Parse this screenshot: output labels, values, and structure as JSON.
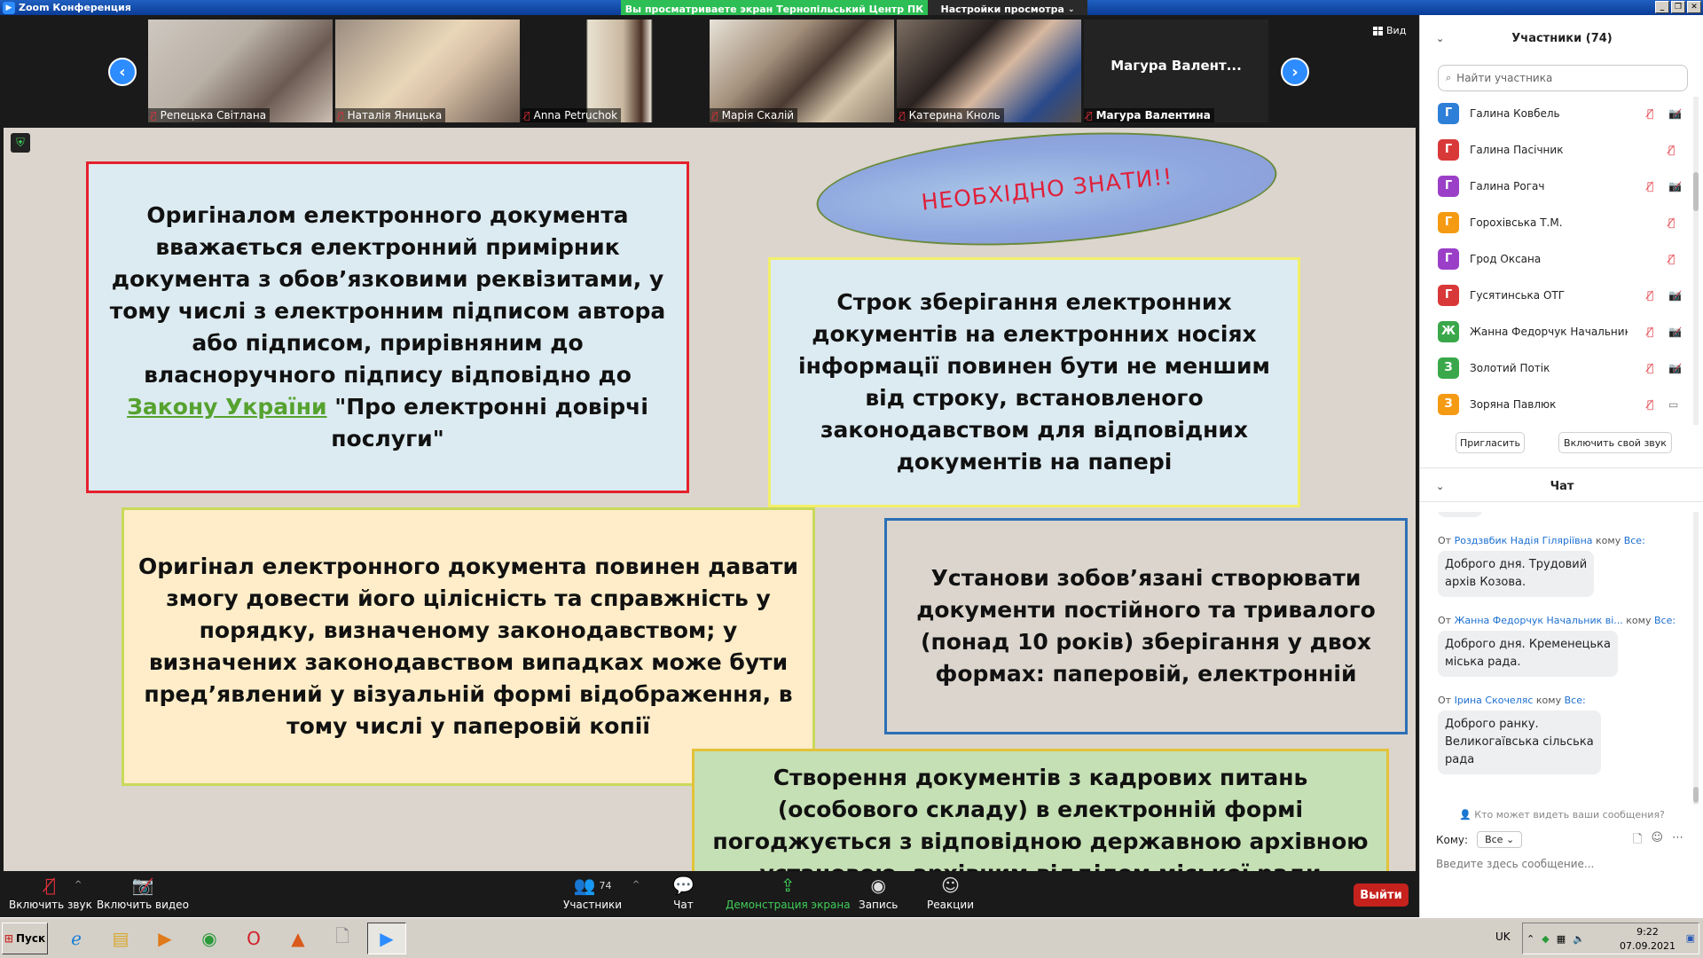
{
  "window": {
    "title": "Zoom Конференция",
    "share_banner": "Вы просматриваете экран Тернопільський Центр ПК",
    "view_settings": "Настройки просмотра"
  },
  "video_strip": {
    "view_label": "Вид",
    "tiles": [
      {
        "name": "Репецька Світлана"
      },
      {
        "name": "Наталія Яницька"
      },
      {
        "name": "Anna Petruchok"
      },
      {
        "name": "Марія Скалій"
      },
      {
        "name": "Катерина Кноль"
      },
      {
        "name": "Магура Валентина",
        "display": "Магура  Валент..."
      }
    ]
  },
  "slide": {
    "ellipse_text": "НЕОБХІДНО ЗНАТИ!!",
    "box1": {
      "before": "Оригіналом електронного документа вважається електронний примірник документа з обов’язковими реквізитами, у тому числі з електронним підписом автора або підписом, прирівняним до власноручного підпису відповідно до ",
      "link": "Закону України",
      "after": " \"Про електронні довірчі послуги\""
    },
    "box2": "Строк зберігання електронних документів на електронних носіях інформації повинен бути не меншим від строку, встановленого законодавством для відповідних документів на папері",
    "box3": "Оригінал електронного документа повинен давати змогу довести його цілісність та справжність у порядку, визначеному законодавством; у визначених законодавством випадках може бути пред’явлений у візуальній формі відображення, в тому числі у паперовій копії",
    "box4": "Установи зобов’язані створювати документи постійного та тривалого (понад 10 років) зберігання у двох формах: паперовій, електронній",
    "box5": "Створення документів з кадрових питань (особового складу) в електронній формі погоджується з відповідною державною архівною установою, архівним відділом міської ради"
  },
  "toolbar": {
    "audio": "Включить звук",
    "video": "Включить видео",
    "participants": "Участники",
    "participants_count": "74",
    "chat": "Чат",
    "share": "Демонстрация экрана",
    "record": "Запись",
    "reactions": "Реакции",
    "leave": "Выйти"
  },
  "participants_panel": {
    "title": "Участники (74)",
    "search_placeholder": "Найти участника",
    "items": [
      {
        "initial": "Г",
        "name": "Галина Ковбель",
        "color": "#2d7fd8",
        "cam": "off"
      },
      {
        "initial": "Г",
        "name": "Галина Пасічник",
        "color": "#d93838",
        "cam": "none"
      },
      {
        "initial": "Г",
        "name": "Галина Рогач",
        "color": "#9b3fc8",
        "cam": "off"
      },
      {
        "initial": "Г",
        "name": "Горохівська Т.М.",
        "color": "#f59a13",
        "cam": "none"
      },
      {
        "initial": "Г",
        "name": "Грод Оксана",
        "color": "#9b3fc8",
        "cam": "none"
      },
      {
        "initial": "Г",
        "name": "Гусятинська ОТГ",
        "color": "#d93838",
        "cam": "off"
      },
      {
        "initial": "Ж",
        "name": "Жанна Федорчук Начальник ві...",
        "color": "#3aa84a",
        "cam": "off"
      },
      {
        "initial": "З",
        "name": "Золотий Потік",
        "color": "#3aa84a",
        "cam": "off"
      },
      {
        "initial": "З",
        "name": "Зоряна Павлюк",
        "color": "#f59a13",
        "cam": "on"
      }
    ],
    "invite": "Пригласить",
    "unmute": "Включить свой звук"
  },
  "chat_panel": {
    "title": "Чат",
    "from": "От",
    "to": "кому",
    "everyone": "Все:",
    "messages": [
      {
        "sender": "Роздзвбик Надія Гіляріївна",
        "lines": [
          "Доброго дня. Трудовий",
          "архів Козова."
        ]
      },
      {
        "sender": "Жанна Федорчук Начальник ві...",
        "lines": [
          "Доброго дня. Кременецька",
          "міська рада."
        ]
      },
      {
        "sender": "Ірина Скочеляс",
        "lines": [
          "Доброго ранку.",
          "Великогаївська сільська",
          "рада"
        ]
      }
    ],
    "who_sees": "Кто может видеть ваши сообщения?",
    "to_label": "Кому:",
    "to_value": "Все",
    "input_placeholder": "Введите здесь сообщение..."
  },
  "taskbar": {
    "start": "Пуск",
    "lang": "UK",
    "time": "9:22",
    "date": "07.09.2021"
  }
}
